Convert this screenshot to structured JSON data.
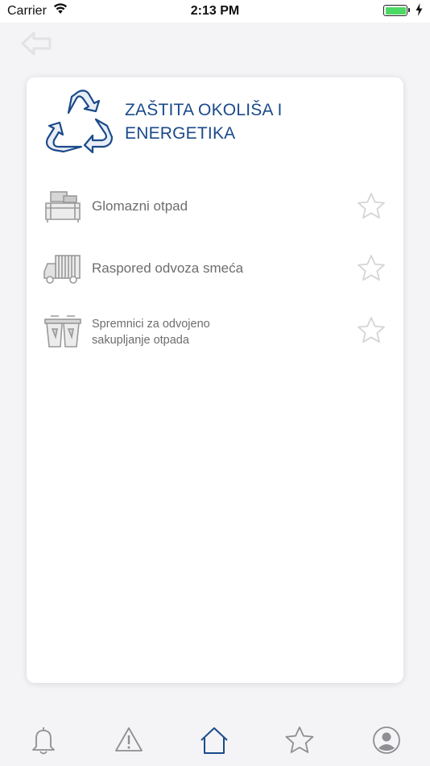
{
  "status_bar": {
    "carrier": "Carrier",
    "time": "2:13 PM",
    "battery_color": "#4cd964"
  },
  "navigation": {
    "back_icon": "arrow-left-icon"
  },
  "card": {
    "logo_icon": "recycle-icon",
    "title": "ZAŠTITA OKOLIŠA I ENERGETIKA",
    "items": [
      {
        "label": "Glomazni otpad",
        "icon": "sofa-icon",
        "favorite_icon": "star-outline-icon"
      },
      {
        "label": "Raspored odvoza smeća",
        "icon": "garbage-truck-icon",
        "favorite_icon": "star-outline-icon"
      },
      {
        "label": "Spremnici za odvojeno sakupljanje otpada",
        "icon": "waste-bins-icon",
        "favorite_icon": "star-outline-icon"
      }
    ]
  },
  "tab_bar": {
    "tabs": [
      {
        "icon": "bell-icon"
      },
      {
        "icon": "warning-icon"
      },
      {
        "icon": "home-icon",
        "active": true
      },
      {
        "icon": "star-icon"
      },
      {
        "icon": "user-icon"
      }
    ],
    "active_color": "#1b4a8a",
    "inactive_color": "#8e8e93"
  },
  "colors": {
    "accent": "#1b4a8a",
    "background": "#f4f4f6",
    "card": "#ffffff"
  }
}
